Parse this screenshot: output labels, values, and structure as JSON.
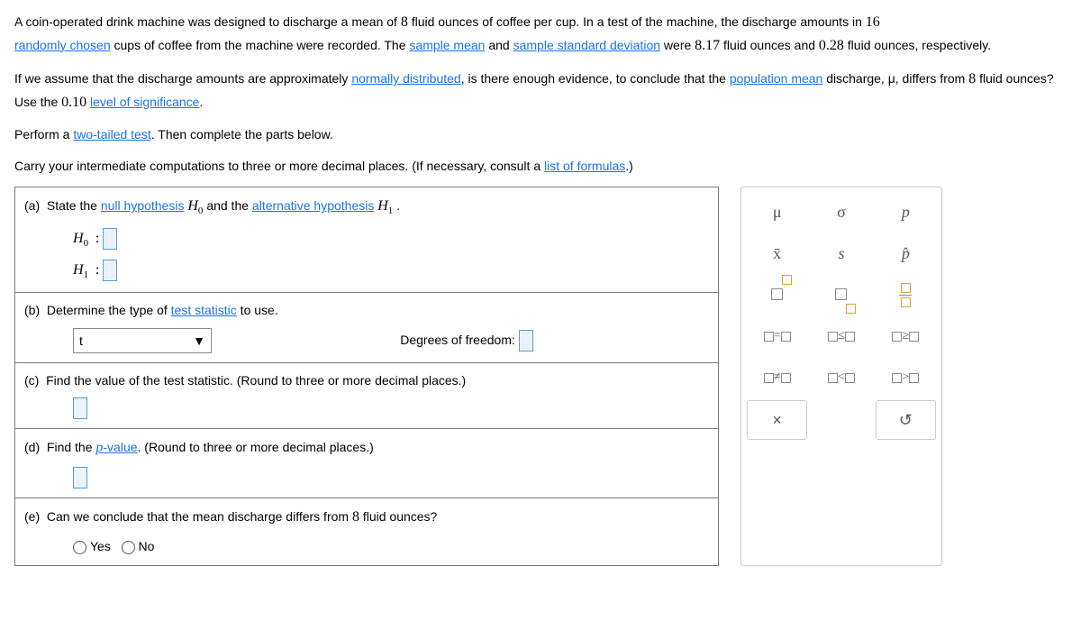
{
  "intro": {
    "p1_a": "A coin-operated drink machine was designed to discharge a mean of ",
    "p1_mean": "8",
    "p1_b": " fluid ounces of coffee per cup. In a test of the machine, the discharge amounts in ",
    "p1_n": "16",
    "p1_c_link": "randomly chosen",
    "p1_d": " cups of coffee from the machine were recorded. The ",
    "p1_link_mean": "sample mean",
    "p1_e": " and ",
    "p1_link_sd": "sample standard deviation",
    "p1_f": " were ",
    "p1_xbar": "8.17",
    "p1_g": " fluid ounces and ",
    "p1_s": "0.28",
    "p1_h": " fluid ounces, respectively.",
    "p2_a": "If we assume that the discharge amounts are approximately ",
    "p2_link_nd": "normally distributed",
    "p2_b": ", is there enough evidence, to conclude that the ",
    "p2_link_pm": "population mean",
    "p2_c": " discharge, μ, differs from ",
    "p2_mean": "8",
    "p2_d": " fluid ounces? Use the ",
    "p2_alpha": "0.10",
    "p2_link_sig": "level of significance",
    "p2_e": ".",
    "p3_a": "Perform a ",
    "p3_link_tt": "two-tailed test",
    "p3_b": ". Then complete the parts below.",
    "p4_a": "Carry your intermediate computations to three or more decimal places. (If necessary, consult a ",
    "p4_link_lf": "list of formulas",
    "p4_b": ".)"
  },
  "parts": {
    "a": {
      "label": "(a)",
      "text_a": "State the ",
      "link_nh": "null hypothesis",
      "h0": "H",
      "h0sub": "0",
      "text_b": " and the ",
      "link_ah": "alternative hypothesis",
      "h1": "H",
      "h1sub": "1",
      "text_c": " .",
      "row_h0": "H",
      "row_h0_sub": "0",
      "row_h1": "H",
      "row_h1_sub": "1",
      "colon": ":"
    },
    "b": {
      "label": "(b)",
      "text_a": "Determine the type of ",
      "link_ts": "test statistic",
      "text_b": " to use.",
      "select_value": "t",
      "df_label": "Degrees of freedom:"
    },
    "c": {
      "label": "(c)",
      "text": "Find the value of the test statistic. (Round to three or more decimal places.)"
    },
    "d": {
      "label": "(d)",
      "text_a": "Find the ",
      "link_pv": "p",
      "link_pv2": "-value",
      "text_b": ". (Round to three or more decimal places.)"
    },
    "e": {
      "label": "(e)",
      "text_a": "Can we conclude that the mean discharge differs from ",
      "val": "8",
      "text_b": " fluid ounces?",
      "yes": "Yes",
      "no": "No"
    }
  },
  "palette": {
    "mu": "μ",
    "sigma": "σ",
    "p": "p",
    "xbar": "x̄",
    "s": "s",
    "phat": "p̂",
    "eq": "☐=☐",
    "le": "☐≤☐",
    "ge": "☐≥☐",
    "ne": "☐≠☐",
    "lt": "☐<☐",
    "gt": "☐>☐",
    "close": "×",
    "reset": "↺"
  }
}
